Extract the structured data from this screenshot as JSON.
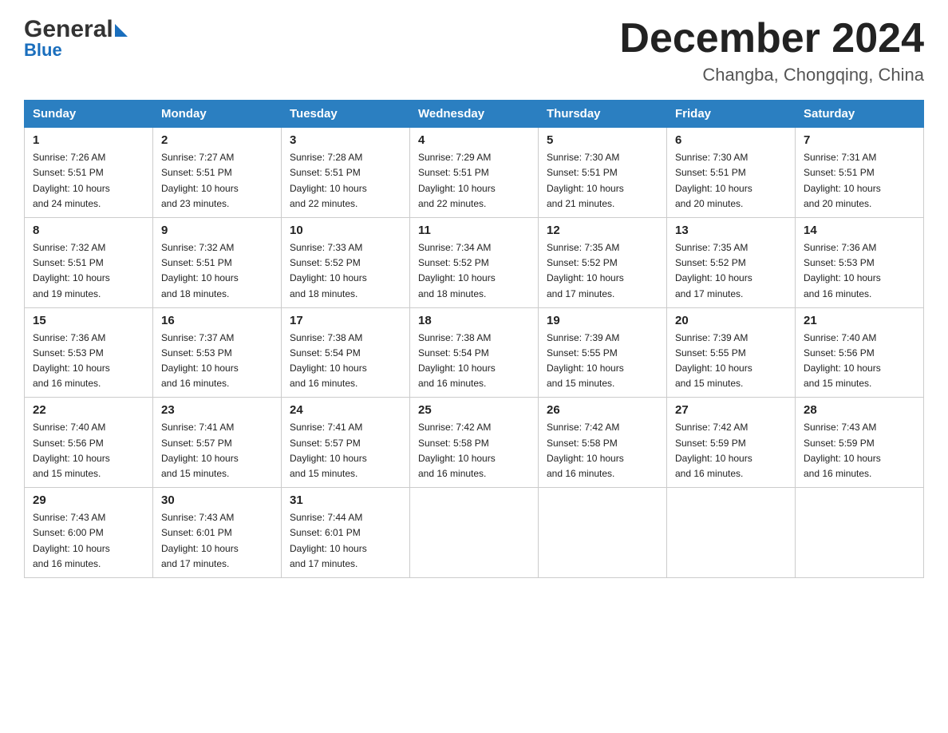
{
  "header": {
    "logo_general": "General",
    "logo_blue": "Blue",
    "title": "December 2024",
    "location": "Changba, Chongqing, China"
  },
  "days_of_week": [
    "Sunday",
    "Monday",
    "Tuesday",
    "Wednesday",
    "Thursday",
    "Friday",
    "Saturday"
  ],
  "weeks": [
    [
      {
        "day": "1",
        "sunrise": "7:26 AM",
        "sunset": "5:51 PM",
        "daylight": "10 hours and 24 minutes."
      },
      {
        "day": "2",
        "sunrise": "7:27 AM",
        "sunset": "5:51 PM",
        "daylight": "10 hours and 23 minutes."
      },
      {
        "day": "3",
        "sunrise": "7:28 AM",
        "sunset": "5:51 PM",
        "daylight": "10 hours and 22 minutes."
      },
      {
        "day": "4",
        "sunrise": "7:29 AM",
        "sunset": "5:51 PM",
        "daylight": "10 hours and 22 minutes."
      },
      {
        "day": "5",
        "sunrise": "7:30 AM",
        "sunset": "5:51 PM",
        "daylight": "10 hours and 21 minutes."
      },
      {
        "day": "6",
        "sunrise": "7:30 AM",
        "sunset": "5:51 PM",
        "daylight": "10 hours and 20 minutes."
      },
      {
        "day": "7",
        "sunrise": "7:31 AM",
        "sunset": "5:51 PM",
        "daylight": "10 hours and 20 minutes."
      }
    ],
    [
      {
        "day": "8",
        "sunrise": "7:32 AM",
        "sunset": "5:51 PM",
        "daylight": "10 hours and 19 minutes."
      },
      {
        "day": "9",
        "sunrise": "7:32 AM",
        "sunset": "5:51 PM",
        "daylight": "10 hours and 18 minutes."
      },
      {
        "day": "10",
        "sunrise": "7:33 AM",
        "sunset": "5:52 PM",
        "daylight": "10 hours and 18 minutes."
      },
      {
        "day": "11",
        "sunrise": "7:34 AM",
        "sunset": "5:52 PM",
        "daylight": "10 hours and 18 minutes."
      },
      {
        "day": "12",
        "sunrise": "7:35 AM",
        "sunset": "5:52 PM",
        "daylight": "10 hours and 17 minutes."
      },
      {
        "day": "13",
        "sunrise": "7:35 AM",
        "sunset": "5:52 PM",
        "daylight": "10 hours and 17 minutes."
      },
      {
        "day": "14",
        "sunrise": "7:36 AM",
        "sunset": "5:53 PM",
        "daylight": "10 hours and 16 minutes."
      }
    ],
    [
      {
        "day": "15",
        "sunrise": "7:36 AM",
        "sunset": "5:53 PM",
        "daylight": "10 hours and 16 minutes."
      },
      {
        "day": "16",
        "sunrise": "7:37 AM",
        "sunset": "5:53 PM",
        "daylight": "10 hours and 16 minutes."
      },
      {
        "day": "17",
        "sunrise": "7:38 AM",
        "sunset": "5:54 PM",
        "daylight": "10 hours and 16 minutes."
      },
      {
        "day": "18",
        "sunrise": "7:38 AM",
        "sunset": "5:54 PM",
        "daylight": "10 hours and 16 minutes."
      },
      {
        "day": "19",
        "sunrise": "7:39 AM",
        "sunset": "5:55 PM",
        "daylight": "10 hours and 15 minutes."
      },
      {
        "day": "20",
        "sunrise": "7:39 AM",
        "sunset": "5:55 PM",
        "daylight": "10 hours and 15 minutes."
      },
      {
        "day": "21",
        "sunrise": "7:40 AM",
        "sunset": "5:56 PM",
        "daylight": "10 hours and 15 minutes."
      }
    ],
    [
      {
        "day": "22",
        "sunrise": "7:40 AM",
        "sunset": "5:56 PM",
        "daylight": "10 hours and 15 minutes."
      },
      {
        "day": "23",
        "sunrise": "7:41 AM",
        "sunset": "5:57 PM",
        "daylight": "10 hours and 15 minutes."
      },
      {
        "day": "24",
        "sunrise": "7:41 AM",
        "sunset": "5:57 PM",
        "daylight": "10 hours and 15 minutes."
      },
      {
        "day": "25",
        "sunrise": "7:42 AM",
        "sunset": "5:58 PM",
        "daylight": "10 hours and 16 minutes."
      },
      {
        "day": "26",
        "sunrise": "7:42 AM",
        "sunset": "5:58 PM",
        "daylight": "10 hours and 16 minutes."
      },
      {
        "day": "27",
        "sunrise": "7:42 AM",
        "sunset": "5:59 PM",
        "daylight": "10 hours and 16 minutes."
      },
      {
        "day": "28",
        "sunrise": "7:43 AM",
        "sunset": "5:59 PM",
        "daylight": "10 hours and 16 minutes."
      }
    ],
    [
      {
        "day": "29",
        "sunrise": "7:43 AM",
        "sunset": "6:00 PM",
        "daylight": "10 hours and 16 minutes."
      },
      {
        "day": "30",
        "sunrise": "7:43 AM",
        "sunset": "6:01 PM",
        "daylight": "10 hours and 17 minutes."
      },
      {
        "day": "31",
        "sunrise": "7:44 AM",
        "sunset": "6:01 PM",
        "daylight": "10 hours and 17 minutes."
      },
      null,
      null,
      null,
      null
    ]
  ],
  "labels": {
    "sunrise": "Sunrise:",
    "sunset": "Sunset:",
    "daylight": "Daylight:"
  }
}
